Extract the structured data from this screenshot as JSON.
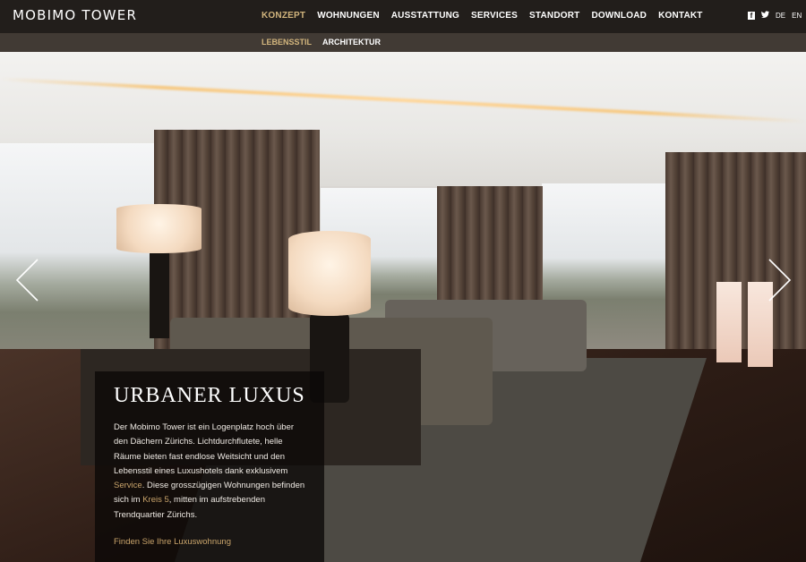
{
  "header": {
    "logo": "MOBIMO TOWER",
    "nav": [
      {
        "label": "KONZEPT",
        "active": true
      },
      {
        "label": "WOHNUNGEN",
        "active": false
      },
      {
        "label": "AUSSTATTUNG",
        "active": false
      },
      {
        "label": "SERVICES",
        "active": false
      },
      {
        "label": "STANDORT",
        "active": false
      },
      {
        "label": "DOWNLOAD",
        "active": false
      },
      {
        "label": "KONTAKT",
        "active": false
      }
    ],
    "social": {
      "facebook_icon": "f",
      "twitter_icon": "twitter-bird"
    },
    "languages": [
      "DE",
      "EN"
    ]
  },
  "subnav": [
    {
      "label": "LEBENSSTIL",
      "active": true
    },
    {
      "label": "ARCHITEKTUR",
      "active": false
    }
  ],
  "hero": {
    "title": "URBANER LUXUS",
    "text_1": "Der Mobimo Tower ist ein Logenplatz hoch über den Dächern Zürichs. Lichtdurchflutete, helle Räume  bieten fast endlose Weitsicht und den Lebensstil eines Luxushotels dank exklusivem ",
    "link_service": "Service",
    "text_2": ". Diese grosszügigen Wohnungen befinden sich im ",
    "link_kreis": "Kreis 5",
    "text_3": ", mitten im aufstrebenden Trendquartier Zürichs.",
    "cta": "Finden Sie Ihre Luxuswohnung"
  },
  "colors": {
    "accent": "#d2b57d",
    "link": "#c9a46b",
    "topbar": "#15110e",
    "subbar": "#38302a"
  }
}
